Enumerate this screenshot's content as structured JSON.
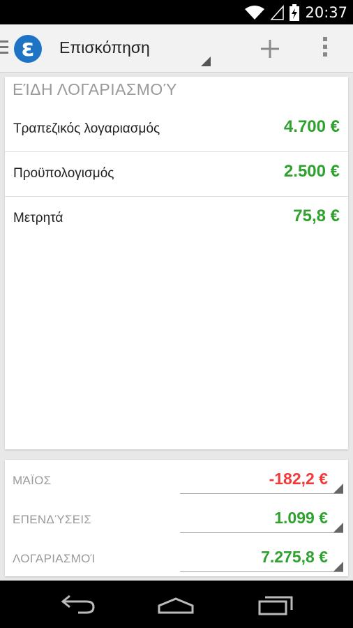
{
  "status_bar": {
    "time": "20:37",
    "icons": [
      "wifi-icon",
      "signal-icon",
      "battery-charging-icon"
    ]
  },
  "action_bar": {
    "logo_letter": "ε",
    "title": "Επισκόπηση",
    "actions": [
      "add-icon",
      "overflow-menu-icon"
    ]
  },
  "accounts": {
    "header": "ΕΊΔΗ ΛΟΓΑΡΙΑΣΜΟΎ",
    "rows": [
      {
        "name": "Τραπεζικός λογαριασμός",
        "amount": "4.700 €"
      },
      {
        "name": "Προϋπολογισμός",
        "amount": "2.500 €"
      },
      {
        "name": "Μετρητά",
        "amount": "75,8 €"
      }
    ]
  },
  "summary": {
    "rows": [
      {
        "label": "ΜΆΪΟΣ",
        "value": "-182,2 €",
        "color": "#f03a3a"
      },
      {
        "label": "ΕΠΕΝΔΎΣΕΙΣ",
        "value": "1.099 €",
        "color": "#2ea12e"
      },
      {
        "label": "ΛΟΓΑΡΙΑΣΜΟΊ",
        "value": "7.275,8 €",
        "color": "#2ea12e"
      }
    ]
  },
  "colors": {
    "positive": "#2ea12e",
    "negative": "#f03a3a",
    "brand": "#1e73c4"
  },
  "nav_bar": [
    "back-icon",
    "home-icon",
    "recents-icon"
  ]
}
